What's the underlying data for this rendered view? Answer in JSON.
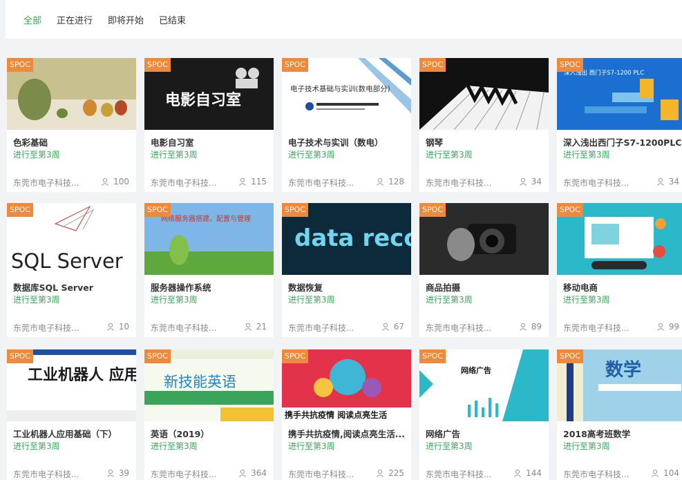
{
  "tabs": [
    {
      "label": "全部",
      "active": true
    },
    {
      "label": "正在进行",
      "active": false
    },
    {
      "label": "即将开始",
      "active": false
    },
    {
      "label": "已结束",
      "active": false
    }
  ],
  "tag_label": "SPOC",
  "colors": {
    "accent": "#3aa55a",
    "tag": "#f08a3a"
  },
  "courses": [
    {
      "title": "色彩基础",
      "status": "进行至第3周",
      "school": "东莞市电子科技...",
      "count": "100",
      "thumb_text": ""
    },
    {
      "title": "电影自习室",
      "status": "进行至第3周",
      "school": "东莞市电子科技...",
      "count": "115",
      "thumb_text": "电影自习室"
    },
    {
      "title": "电子技术与实训（数电）",
      "status": "进行至第3周",
      "school": "东莞市电子科技...",
      "count": "128",
      "thumb_text": "电子技术基础与实训(数电部分)"
    },
    {
      "title": "钢琴",
      "status": "进行至第3周",
      "school": "东莞市电子科技...",
      "count": "34",
      "thumb_text": ""
    },
    {
      "title": "深入浅出西门子S7-1200PLC",
      "status": "进行至第3周",
      "school": "东莞市电子科技...",
      "count": "34",
      "thumb_text": "深入浅出 西门子S7-1200 PLC"
    },
    {
      "title": "数据库SQL Server",
      "status": "进行至第3周",
      "school": "东莞市电子科技...",
      "count": "10",
      "thumb_text": "SQL Server"
    },
    {
      "title": "服务器操作系统",
      "status": "进行至第3周",
      "school": "东莞市电子科技...",
      "count": "21",
      "thumb_text": "网络服务器搭建、配置与管理"
    },
    {
      "title": "数据恢复",
      "status": "进行至第3周",
      "school": "东莞市电子科技...",
      "count": "67",
      "thumb_text": "data recovery"
    },
    {
      "title": "商品拍摄",
      "status": "进行至第3周",
      "school": "东莞市电子科技...",
      "count": "89",
      "thumb_text": ""
    },
    {
      "title": "移动电商",
      "status": "进行至第3周",
      "school": "东莞市电子科技...",
      "count": "99",
      "thumb_text": ""
    },
    {
      "title": "工业机器人应用基础（下）",
      "status": "进行至第3周",
      "school": "东莞市电子科技...",
      "count": "39",
      "thumb_text": "工业机器人 应用基础"
    },
    {
      "title": "英语（2019）",
      "status": "进行至第3周",
      "school": "东莞市电子科技...",
      "count": "364",
      "thumb_text": "新技能英语"
    },
    {
      "title": "携手共抗疫情,阅读点亮生活...",
      "status": "进行至第3周",
      "school": "东莞市电子科技...",
      "count": "225",
      "thumb_text": "携手共抗疫情 阅读点亮生活"
    },
    {
      "title": "网络广告",
      "status": "进行至第3周",
      "school": "东莞市电子科技...",
      "count": "144",
      "thumb_text": "网络广告"
    },
    {
      "title": "2018高考班数学",
      "status": "进行至第3周",
      "school": "东莞市电子科技...",
      "count": "104",
      "thumb_text": "数学"
    }
  ]
}
